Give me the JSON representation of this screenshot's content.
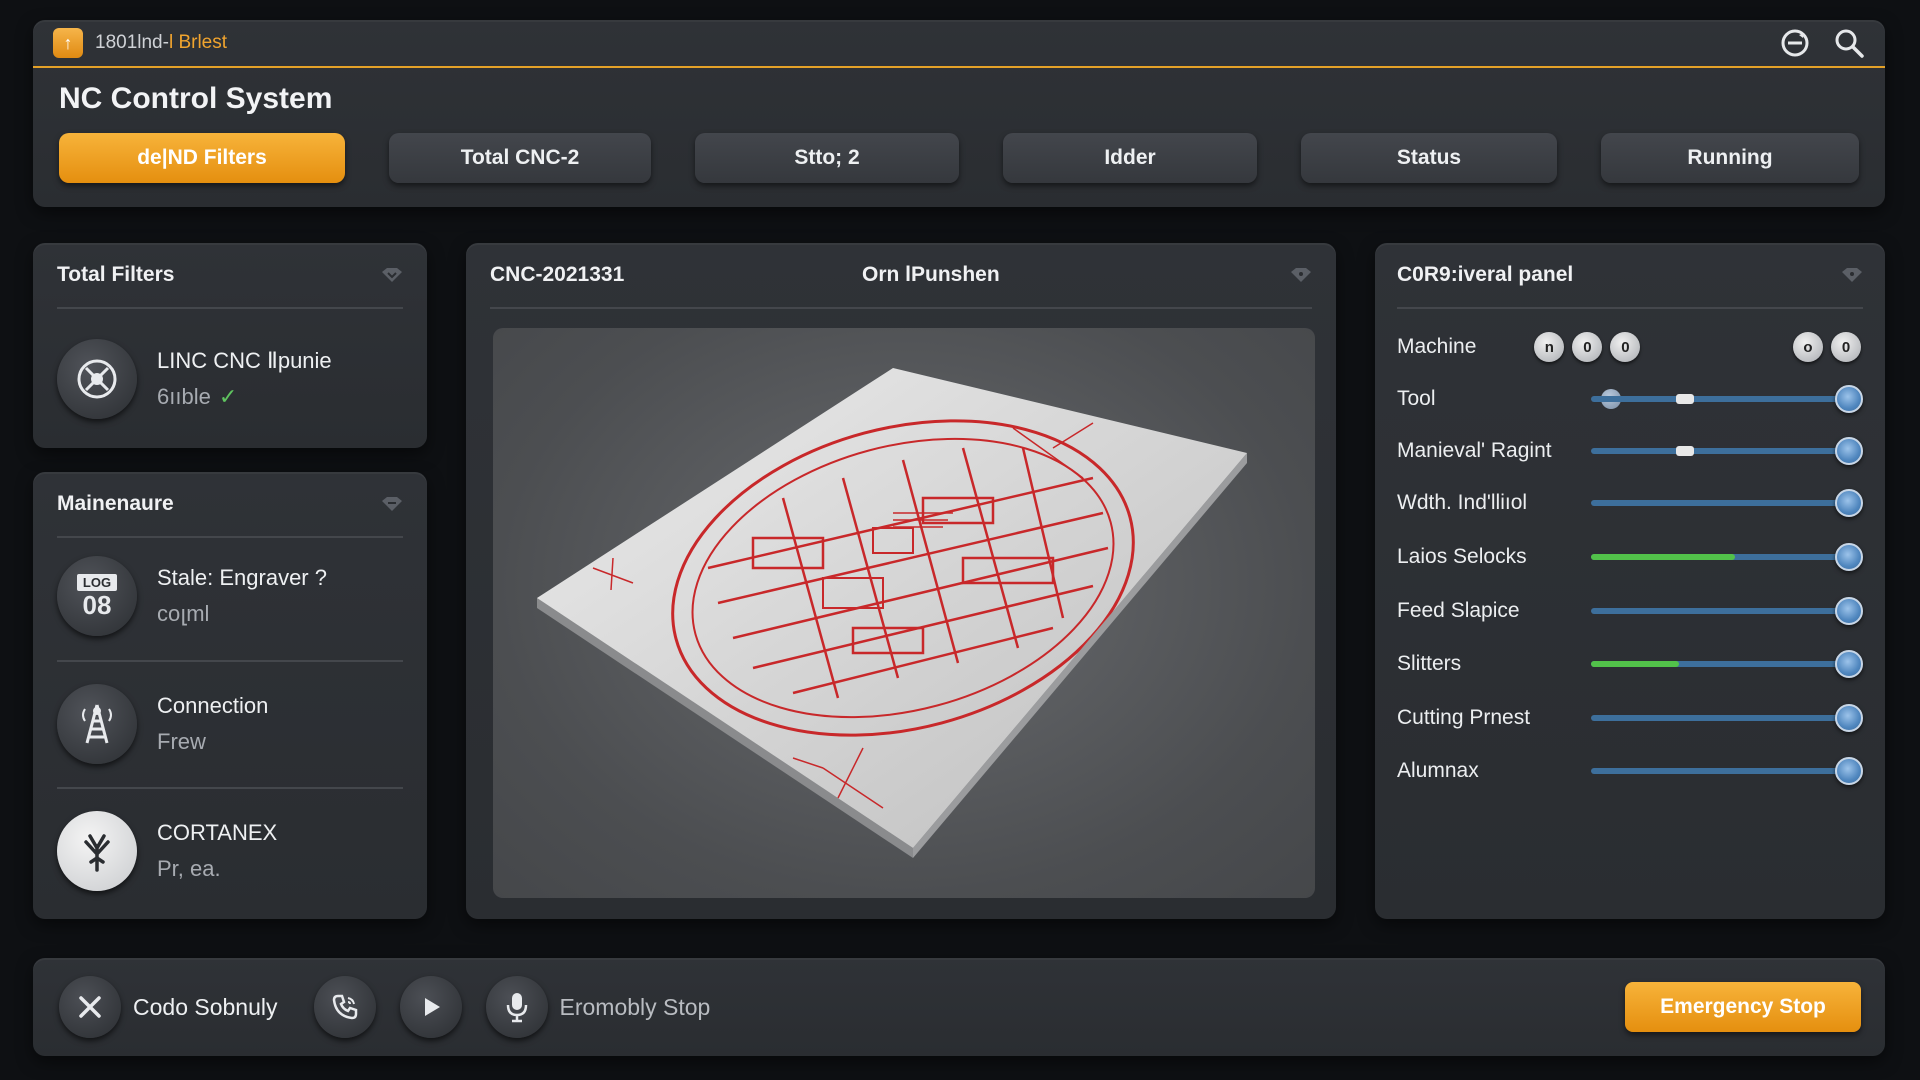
{
  "app": {
    "name_prefix": "1801lnd-",
    "name_accent": "l Brlest",
    "title": "NC Control System"
  },
  "titlebar": {
    "icons": [
      "refresh-icon",
      "search-icon"
    ]
  },
  "tabs": [
    {
      "label": "de|ND Filters",
      "active": true
    },
    {
      "label": "Total CNC-2",
      "active": false
    },
    {
      "label": "Stto; 2",
      "active": false
    },
    {
      "label": "Idder",
      "active": false
    },
    {
      "label": "Status",
      "active": false
    },
    {
      "label": "Running",
      "active": false
    }
  ],
  "filters_panel": {
    "title": "Total Filters",
    "item": {
      "name": "LINC CNC Ⅱpunie",
      "status": "6ııble",
      "ok": true,
      "icon": "compass-icon"
    }
  },
  "maintenance_panel": {
    "title": "Mainenaure",
    "items": [
      {
        "name": "Stale: Engraver ?",
        "sub": "coլml",
        "icon": "log-icon",
        "icon_top": "LOG",
        "icon_bottom": "08"
      },
      {
        "name": "Connection",
        "sub": "Frew",
        "icon": "tower-icon"
      },
      {
        "name": "CORTANEX",
        "sub": "Pr, ea.",
        "icon": "tree-icon"
      }
    ]
  },
  "preview_panel": {
    "title": "CNC-2021331",
    "subtitle": "Orn lPunshen"
  },
  "control_panel": {
    "title": "C0R9:iveral panel",
    "machine": {
      "label": "Machine",
      "knobs": [
        "n",
        "0",
        "0"
      ],
      "knobs_right": [
        "o",
        "0"
      ]
    },
    "rows": [
      {
        "label": "Tool",
        "value": 1.0,
        "green": 0,
        "marker": "dot",
        "notch": true
      },
      {
        "label": "Manieval' Ragint",
        "value": 1.0,
        "green": 0,
        "marker": "dash",
        "notch": true
      },
      {
        "label": "Wdth. Ind'lliıol",
        "value": 1.0,
        "green": 0,
        "marker": "none",
        "notch": false
      },
      {
        "label": "Laios Selocks",
        "value": 1.0,
        "green": 0.56,
        "marker": "none",
        "notch": false
      },
      {
        "label": "Feed Slapice",
        "value": 1.0,
        "green": 0,
        "marker": "none",
        "notch": false
      },
      {
        "label": "Slitters",
        "value": 1.0,
        "green": 0.34,
        "marker": "none",
        "notch": false
      },
      {
        "label": "Cutting Prnest",
        "value": 1.0,
        "green": 0,
        "marker": "none",
        "notch": false
      },
      {
        "label": "Alumnax",
        "value": 1.0,
        "green": 0,
        "marker": "none",
        "notch": false
      }
    ]
  },
  "bottom_bar": {
    "close_label": "Codo Sobnuly",
    "mic_label": "Eromobly Stop",
    "estop_label": "Emergency Stop",
    "icons": [
      "close-icon",
      "phone-icon",
      "play-icon",
      "microphone-icon"
    ]
  },
  "colors": {
    "accent": "#f0a42e",
    "slider_blue": "#4f86be",
    "slider_green": "#52c24a",
    "drawing_red": "#c8282a"
  }
}
